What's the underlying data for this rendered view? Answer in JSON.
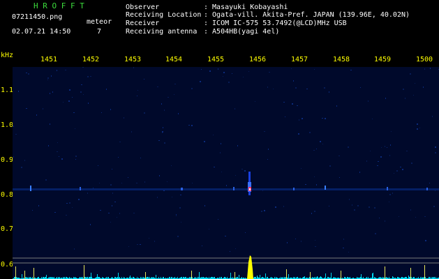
{
  "header": {
    "brand": "H R O F F T",
    "filename": "07211450.png",
    "datetime": "02.07.21 14:50",
    "meteor_label": "meteor",
    "meteor_count": "7",
    "info": [
      {
        "key": "Observer",
        "value": ": Masayuki Kobayashi"
      },
      {
        "key": "Receiving Location",
        "value": ": Ogata-vill. Akita-Pref. JAPAN (139.96E, 40.02N)"
      },
      {
        "key": "Receiver",
        "value": ": ICOM IC-575 53.7492(@LCD)MHz USB"
      },
      {
        "key": "Receiving antenna",
        "value": ": A504HB(yagi 4el)"
      }
    ]
  },
  "axis": {
    "y_unit": "kHz",
    "x_ticks": [
      "1451",
      "1452",
      "1453",
      "1454",
      "1455",
      "1456",
      "1457",
      "1458",
      "1459",
      "1500"
    ],
    "y_ticks": [
      "1.1",
      "1.0",
      "0.9",
      "0.8",
      "0.7",
      "0.6"
    ]
  },
  "colors": {
    "background": "#000000",
    "plot": "#000a2e",
    "axis_text": "#ffff00",
    "brand_green": "#3cdc3c",
    "trace_cyan": "#00e5ff",
    "meteor_head": "#ff3060"
  }
}
